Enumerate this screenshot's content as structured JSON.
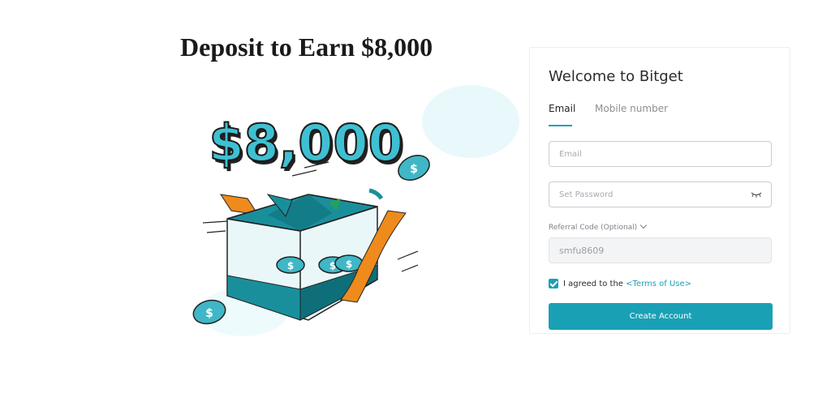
{
  "promo": {
    "headline": "Deposit to Earn $8,000",
    "amount_text": "$8,000"
  },
  "signup": {
    "title": "Welcome to Bitget",
    "tabs": [
      {
        "label": "Email",
        "active": true
      },
      {
        "label": "Mobile number",
        "active": false
      }
    ],
    "email_placeholder": "Email",
    "password_placeholder": "Set Password",
    "referral_label": "Referral Code (Optional)",
    "referral_value": "smfu8609",
    "agree_text": "I agreed to the",
    "terms_link": "<Terms of Use>",
    "agree_checked": true,
    "create_button": "Create Account"
  },
  "icons": {
    "password_toggle": "eye-closed-icon",
    "referral_toggle": "chevron-down-icon",
    "checkbox": "checkmark-icon"
  },
  "colors": {
    "accent": "#1aa0b5",
    "teal_dark": "#0e7c88",
    "orange": "#ef8a1c",
    "coin_fill": "#3fb7c6"
  }
}
